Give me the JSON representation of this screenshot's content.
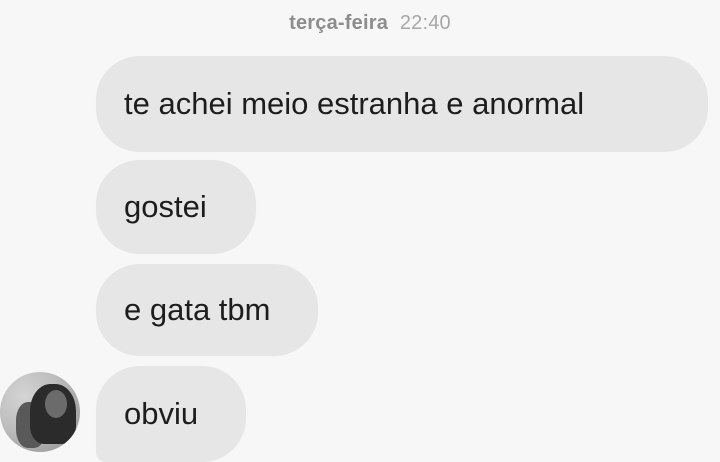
{
  "conversation": {
    "timestamp_day": "terça-feira",
    "timestamp_time": "22:40",
    "messages": [
      "te achei meio estranha e anormal",
      "gostei",
      "e gata tbm",
      "obviu"
    ]
  }
}
